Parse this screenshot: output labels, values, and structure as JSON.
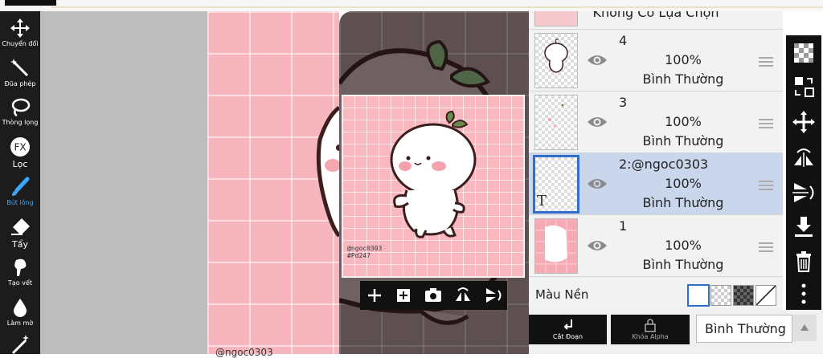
{
  "tools": [
    {
      "label": "Chuyển đổi",
      "icon": "move-icon",
      "active": false
    },
    {
      "label": "Đũa phép",
      "icon": "magic-wand-icon",
      "active": false
    },
    {
      "label": "Thòng lọng",
      "icon": "lasso-icon",
      "active": false
    },
    {
      "label": "Lọc",
      "icon": "fx-filter-icon",
      "active": false
    },
    {
      "label": "Bút lông",
      "icon": "brush-icon",
      "active": true
    },
    {
      "label": "Tẩy",
      "icon": "eraser-icon",
      "active": false
    },
    {
      "label": "Tạo vết",
      "icon": "smudge-icon",
      "active": false
    },
    {
      "label": "Làm mờ",
      "icon": "blur-icon",
      "active": false
    }
  ],
  "preview": {
    "watermark_line1": "@ngoc0303",
    "watermark_line2": "#Pd247"
  },
  "canvas_partial_text": "@ngoc0303",
  "layers": {
    "no_selection": "Không Có Lựa Chọn",
    "items": [
      {
        "name": "4",
        "opacity": "100%",
        "mode": "Bình Thường",
        "selected": false
      },
      {
        "name": "3",
        "opacity": "100%",
        "mode": "Bình Thường",
        "selected": false
      },
      {
        "name": "2:@ngoc0303",
        "opacity": "100%",
        "mode": "Bình Thường",
        "selected": true,
        "thumb_text": "T"
      },
      {
        "name": "1",
        "opacity": "100%",
        "mode": "Bình Thường",
        "selected": false
      }
    ],
    "background_label": "Màu Nền"
  },
  "bottom": {
    "cut_label": "Cắt Đoạn",
    "alpha_lock_label": "Khóa Alpha",
    "blend_mode": "Bình Thường"
  },
  "colors": {
    "selected_layer_bg": "#c9d6eb",
    "selected_border": "#2f6ec9",
    "canvas_pink": "#f7b5bd",
    "active_tool": "#3aa7ff"
  }
}
